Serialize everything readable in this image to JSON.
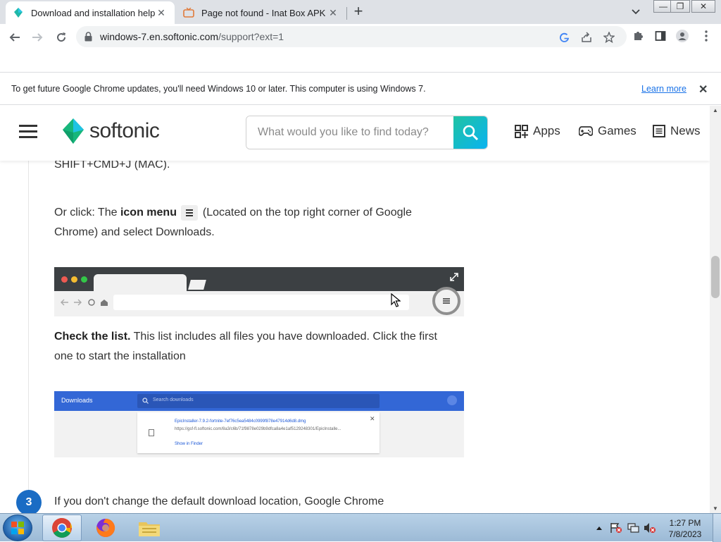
{
  "browser": {
    "tabs": [
      {
        "title": "Download and installation help",
        "active": true
      },
      {
        "title": "Page not found - Inat Box APK",
        "active": false
      }
    ],
    "url_host": "windows-7.en.softonic.com",
    "url_path": "/support?ext=1"
  },
  "infobar": {
    "message": "To get future Google Chrome updates, you'll need Windows 10 or later. This computer is using Windows 7.",
    "link": "Learn more"
  },
  "site": {
    "logo_text": "softonic",
    "search_placeholder": "What would you like to find today?",
    "nav": [
      {
        "label": "Apps",
        "icon": "apps-grid-icon"
      },
      {
        "label": "Games",
        "icon": "gamepad-icon"
      },
      {
        "label": "News",
        "icon": "news-icon"
      }
    ]
  },
  "article": {
    "line_top": "SHIFT+CMD+J (MAC).",
    "or_click_prefix": "Or click:  The ",
    "icon_menu": "icon menu",
    "or_click_suffix": " (Located on the top right corner of Google",
    "or_click_line2": "Chrome) and select Downloads.",
    "check_bold": "Check the list.",
    "check_rest": " This list includes all files you have downloaded. Click the first",
    "check_line2": "one to start the installation",
    "step_number": "3",
    "bottom_line": "If you don't change the default download location, Google Chrome"
  },
  "downloads_mock": {
    "title": "Downloads",
    "search": "Search downloads",
    "file_name": "EpicInstaller-7.9.2-fortnite-7ef76c5ea5484c0999f878e47914d6d8.dmg",
    "file_url": "https://gsf-fl.softonic.com/8a3/c6b/71f9878e029b9dfca8a4e1af5129248301/EpicInstalle...",
    "show_in_finder": "Show in Finder"
  },
  "taskbar": {
    "time": "1:27 PM",
    "date": "7/8/2023"
  },
  "colors": {
    "accent_teal": "#1fc3a3",
    "accent_blue": "#0ab3f0",
    "link_blue": "#1a73e8",
    "step_blue": "#1a6cc4"
  }
}
